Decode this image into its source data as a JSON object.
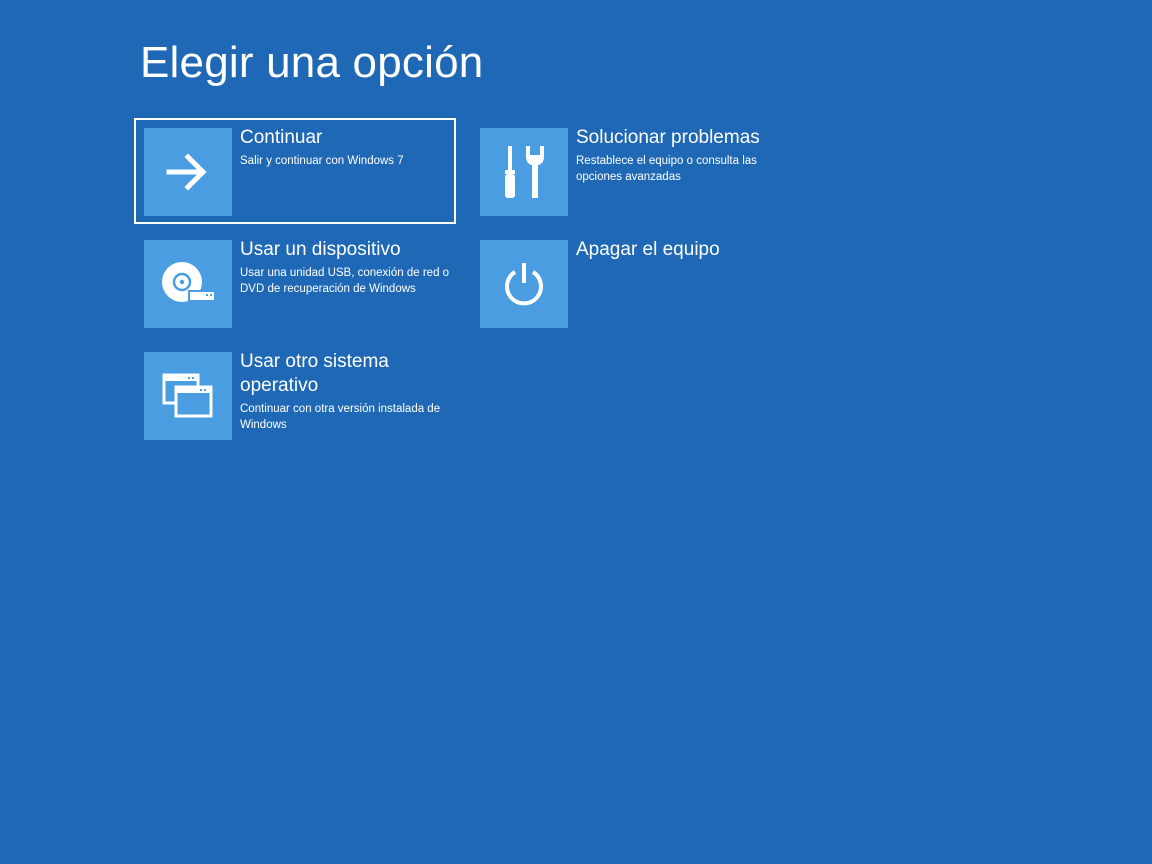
{
  "page": {
    "title": "Elegir una opción",
    "background_color": "#1f68b5",
    "tile_color": "#4a9de0"
  },
  "options": [
    {
      "title": "Continuar",
      "description": "Salir y continuar con Windows 7",
      "icon": "arrow-right-icon",
      "selected": true
    },
    {
      "title": "Solucionar problemas",
      "description": "Restablece el equipo o consulta las opciones avanzadas",
      "icon": "tools-icon",
      "selected": false
    },
    {
      "title": "Usar un dispositivo",
      "description": "Usar una unidad USB, conexión de red o DVD de recuperación de Windows",
      "icon": "disc-usb-icon",
      "selected": false
    },
    {
      "title": "Apagar el equipo",
      "description": "",
      "icon": "power-icon",
      "selected": false
    },
    {
      "title": "Usar otro sistema operativo",
      "description": "Continuar con otra versión instalada de Windows",
      "icon": "windows-stack-icon",
      "selected": false
    }
  ]
}
